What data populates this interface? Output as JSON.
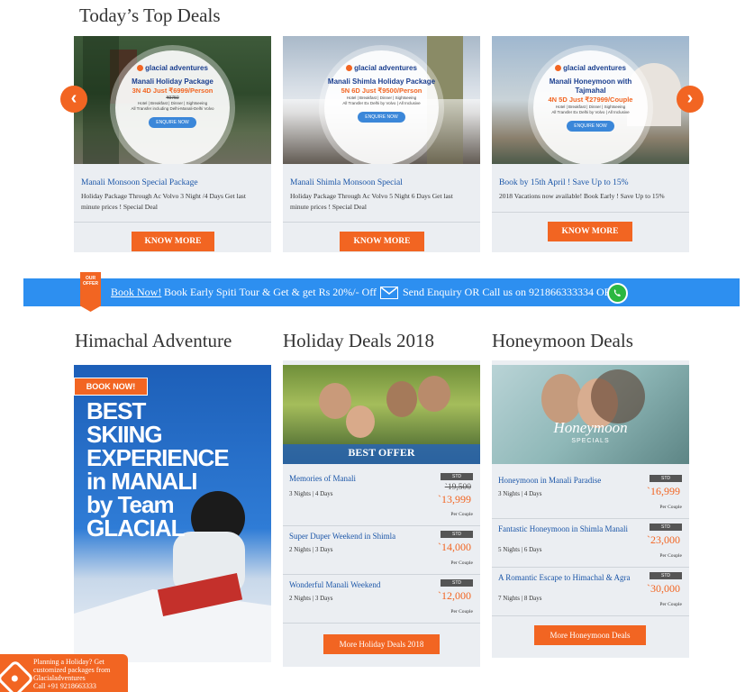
{
  "top_deals": {
    "title": "Today’s Top Deals",
    "cards": [
      {
        "logo": "glacial adventures",
        "package": "Manali Holiday Package",
        "price": "3N 4D Just ₹6999/Person",
        "old_price": "₹9750",
        "inclusions": "Hotel | Breakfast | Dinner | Sightseeing",
        "transfer": "All Transfer including Delhi-Manali-Delhi Volvo",
        "enquire": "ENQUIRE NOW",
        "title": "Manali Monsoon Special Package",
        "desc": "Holiday Package Through Ac Volvo 3 Night /4 Days Get last minute prices ! Special Deal",
        "button": "KNOW MORE"
      },
      {
        "logo": "glacial adventures",
        "package": "Manali Shimla Holiday Package",
        "price": "5N 6D Just ₹9500/Person",
        "inclusions": "Hotel | Breakfast | Dinner | Sightseeing",
        "transfer": "All Transfer Ex Delhi by Volvo | All Inclusive",
        "enquire": "ENQUIRE NOW",
        "title": "Manali Shimla Monsoon Special",
        "desc": "Holiday Package Through Ac Volvo 5 Night 6 Days Get last minute prices ! Special Deal",
        "button": "KNOW MORE"
      },
      {
        "logo": "glacial adventures",
        "package": "Manali Honeymoon with Tajmahal",
        "price": "4N 5D Just ₹27999/Couple",
        "inclusions": "Hotel | Breakfast | Dinner | Sightseeing",
        "transfer": "All Transfer Ex Delhi by Volvo | All Inclusive",
        "enquire": "ENQUIRE NOW",
        "title": "Book by 15th April ! Save Up to 15%",
        "desc": "2018 Vacations now available! Book Early ! Save Up to 15%",
        "button": "KNOW MORE"
      }
    ]
  },
  "banner": {
    "book_now": "Book Now!",
    "text": "Book Early Spiti Tour & Get & get Rs 20%/- Off",
    "enquiry": "Send Enquiry OR Call us on 921866333334 OR",
    "badge": "OUR OFFER"
  },
  "himachal": {
    "title": "Himachal Adventure",
    "book_now": "BOOK NOW!",
    "headline": [
      "BEST",
      "SKIING",
      "EXPERIENCE",
      "in MANALI",
      "by Team",
      "GLACIAL"
    ]
  },
  "holiday": {
    "title": "Holiday Deals 2018",
    "banner": "BEST OFFER",
    "deals": [
      {
        "name": "Memories of Manali",
        "nights": "3 Nights | 4 Days",
        "tag": "STD",
        "old": "`19,500",
        "price": "`13,999",
        "per": "Per Couple"
      },
      {
        "name": "Super Duper Weekend in Shimla",
        "nights": "2 Nights | 3 Days",
        "tag": "STD",
        "price": "`14,000",
        "per": "Per Couple"
      },
      {
        "name": "Wonderful Manali Weekend",
        "nights": "2 Nights | 3 Days",
        "tag": "STD",
        "price": "`12,000",
        "per": "Per Couple"
      }
    ],
    "button": "More Holiday Deals 2018"
  },
  "honeymoon": {
    "title": "Honeymoon Deals",
    "banner": "Honeymoon",
    "banner_sub": "SPECIALS",
    "deals": [
      {
        "name": "Honeymoon in Manali Paradise",
        "nights": "3 Nights | 4 Days",
        "tag": "STD",
        "price": "`16,999",
        "per": "Per Couple"
      },
      {
        "name": "Fantastic Honeymoon in Shimla Manali",
        "nights": "5 Nights | 6 Days",
        "tag": "STD",
        "price": "`23,000",
        "per": "Per Couple"
      },
      {
        "name": "A Romantic Escape to Himachal & Agra",
        "nights": "7 Nights | 8 Days",
        "tag": "STD",
        "price": "`30,000",
        "per": "Per Couple"
      }
    ],
    "button": "More Honeymoon Deals"
  },
  "chat_popup": {
    "line1": "Planning a Holiday? Get",
    "line2": "customized packages from",
    "line3": "Glacialadventures",
    "line4": "Call +91 9218663333"
  },
  "colors": {
    "accent": "#f26522",
    "banner_blue": "#2d8ff0",
    "link": "#1b56a8"
  }
}
